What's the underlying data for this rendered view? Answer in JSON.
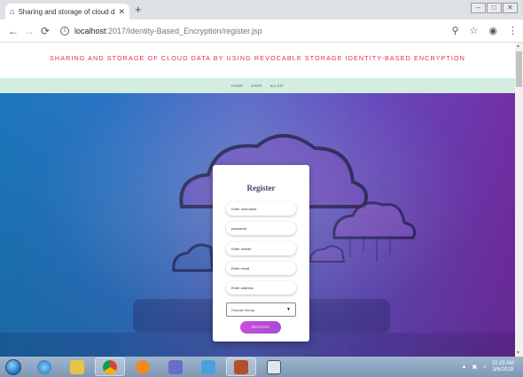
{
  "browser": {
    "tab_title": "Sharing and storage of cloud da",
    "url_host": "localhost",
    "url_path": ":2017/Identity-Based_Encryption/register.jsp"
  },
  "site": {
    "title": "SHARING AND STORAGE OF CLOUD DATA BY USING REVOCABLE STORAGE IDENTITY-BASED ENCRYPTION",
    "nav": [
      "HOME",
      "USER",
      "ALLSIP"
    ]
  },
  "register": {
    "heading": "Register",
    "username_placeholder": "Enter username",
    "password_placeholder": "password",
    "mobile_placeholder": "Enter mobile",
    "email_placeholder": "Enter email",
    "address_placeholder": "Enter address",
    "group_select": "Choose Group",
    "button": "REGISTER"
  },
  "taskbar": {
    "time": "10:25 AM",
    "date": "3/6/2019"
  },
  "colors": {
    "title_red": "#e0303b",
    "nav_bg": "#d3ede3",
    "button_purple": "#c94fd8"
  }
}
